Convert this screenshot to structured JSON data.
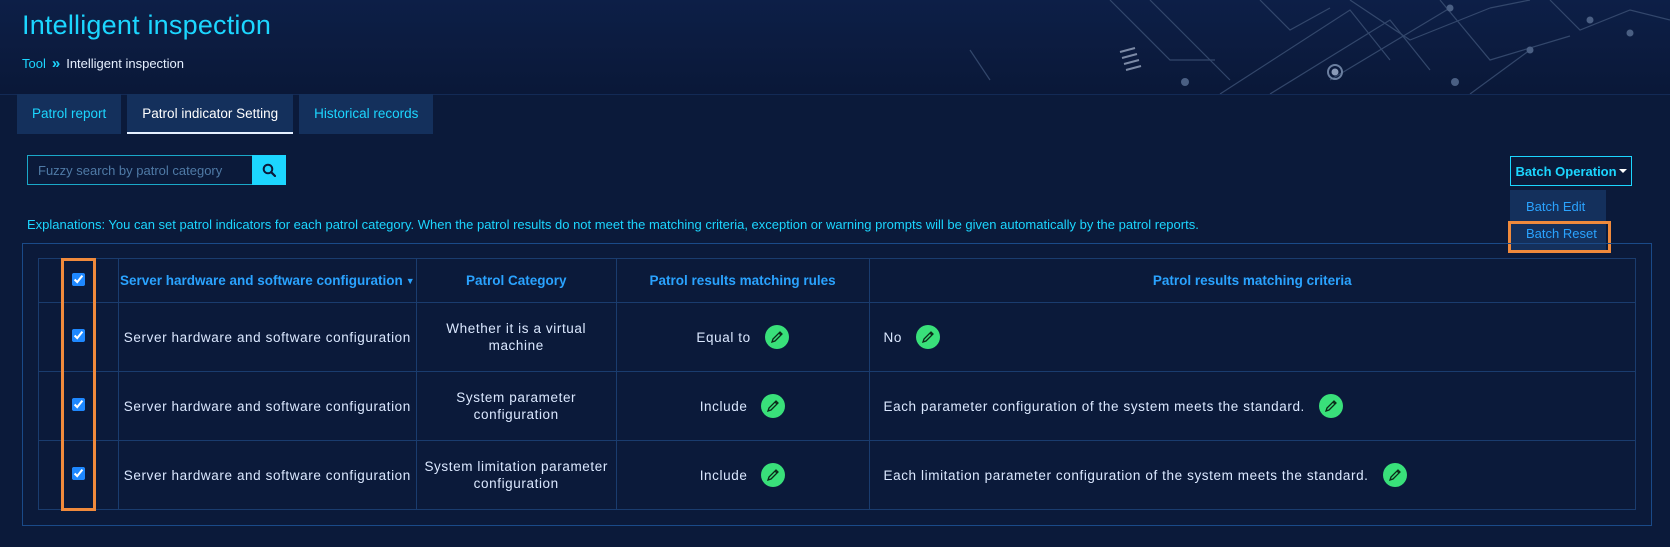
{
  "page": {
    "title": "Intelligent inspection",
    "breadcrumb": {
      "root": "Tool",
      "separator": "»",
      "current": "Intelligent inspection"
    }
  },
  "tabs": [
    {
      "label": "Patrol report",
      "active": false
    },
    {
      "label": "Patrol indicator Setting",
      "active": true
    },
    {
      "label": "Historical records",
      "active": false
    }
  ],
  "search": {
    "placeholder": "Fuzzy search by patrol category",
    "value": "",
    "icon": "search-icon"
  },
  "batch": {
    "label": "Batch Operation",
    "menu": {
      "edit": "Batch Edit",
      "reset": "Batch Reset"
    }
  },
  "explanation": "Explanations: You can set patrol indicators for each patrol category. When the patrol results do not meet the matching criteria, exception or warning prompts will be given automatically by the patrol reports.",
  "table": {
    "headers": {
      "group": "Server hardware and software configuration",
      "category": "Patrol Category",
      "rules": "Patrol results matching rules",
      "criteria": "Patrol results matching criteria"
    },
    "rows": [
      {
        "group": "Server hardware and software configuration",
        "category": "Whether it is a virtual machine",
        "rule": "Equal to",
        "criteria": "No",
        "checked": true
      },
      {
        "group": "Server hardware and software configuration",
        "category": "System parameter configuration",
        "rule": "Include",
        "criteria": "Each parameter configuration of the system meets the standard.",
        "checked": true
      },
      {
        "group": "Server hardware and software configuration",
        "category": "System limitation parameter configuration",
        "rule": "Include",
        "criteria": "Each limitation parameter configuration of the system meets the standard.",
        "checked": true
      }
    ]
  },
  "colors": {
    "background": "#0b1a3a",
    "accent": "#1cd6ff",
    "header_text": "#2aa3ff",
    "edit_button": "#39e07a",
    "highlight": "#f08a3c"
  }
}
